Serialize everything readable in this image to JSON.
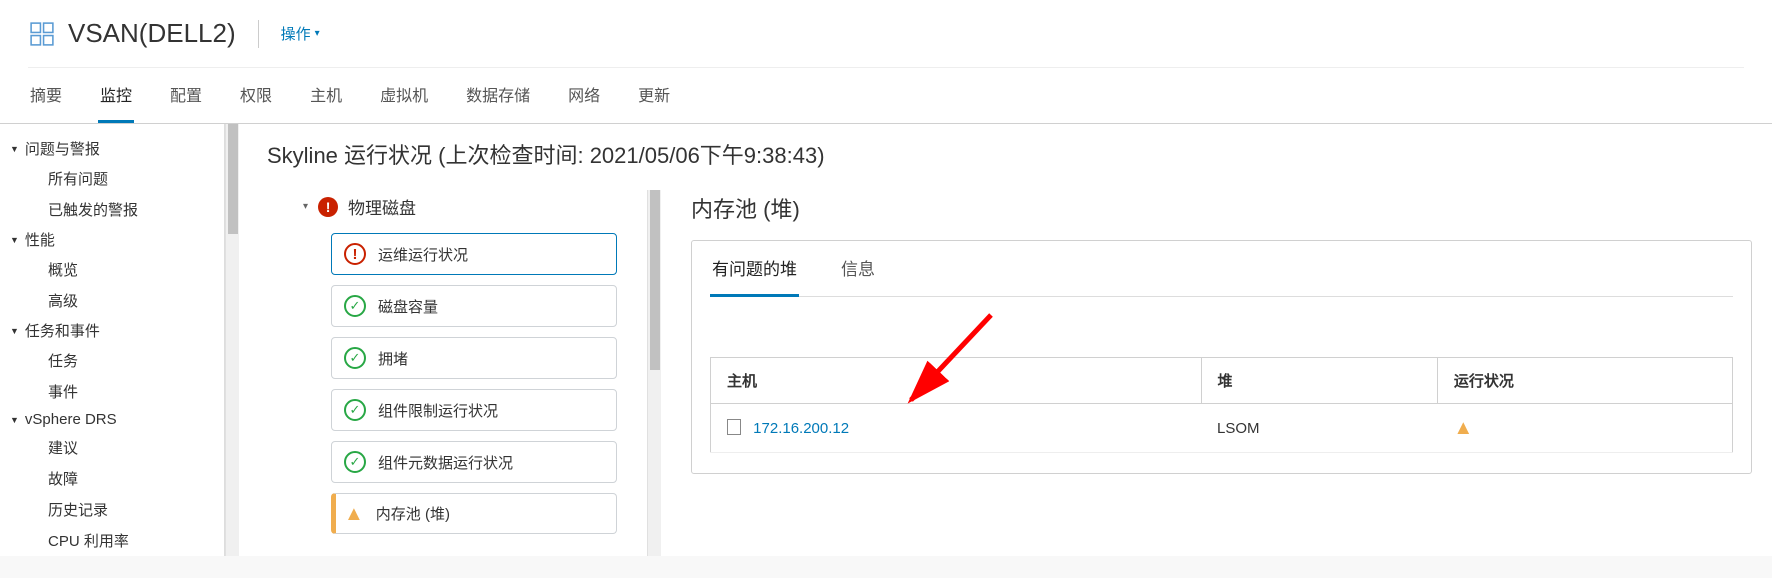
{
  "header": {
    "title": "VSAN(DELL2)",
    "actions_label": "操作"
  },
  "tabs": [
    "摘要",
    "监控",
    "配置",
    "权限",
    "主机",
    "虚拟机",
    "数据存储",
    "网络",
    "更新"
  ],
  "active_tab": 1,
  "sidebar": [
    {
      "title": "问题与警报",
      "items": [
        "所有问题",
        "已触发的警报"
      ]
    },
    {
      "title": "性能",
      "items": [
        "概览",
        "高级"
      ]
    },
    {
      "title": "任务和事件",
      "items": [
        "任务",
        "事件"
      ]
    },
    {
      "title": "vSphere DRS",
      "items": [
        "建议",
        "故障",
        "历史记录",
        "CPU 利用率"
      ]
    }
  ],
  "content": {
    "title": "Skyline 运行状况 (上次检查时间: 2021/05/06下午9:38:43)",
    "health_group": "物理磁盘",
    "checks": [
      {
        "status": "warn",
        "label": "运维运行状况",
        "selected": true
      },
      {
        "status": "ok",
        "label": "磁盘容量"
      },
      {
        "status": "ok",
        "label": "拥堵"
      },
      {
        "status": "ok",
        "label": "组件限制运行状况"
      },
      {
        "status": "ok",
        "label": "组件元数据运行状况"
      },
      {
        "status": "tri",
        "label": "内存池 (堆)",
        "marked": true
      }
    ],
    "right_title": "内存池 (堆)",
    "sub_tabs": [
      "有问题的堆",
      "信息"
    ],
    "active_sub_tab": 0,
    "table": {
      "headers": [
        "主机",
        "堆",
        "运行状况"
      ],
      "row": {
        "host": "172.16.200.12",
        "heap": "LSOM",
        "status": "warn"
      }
    }
  }
}
